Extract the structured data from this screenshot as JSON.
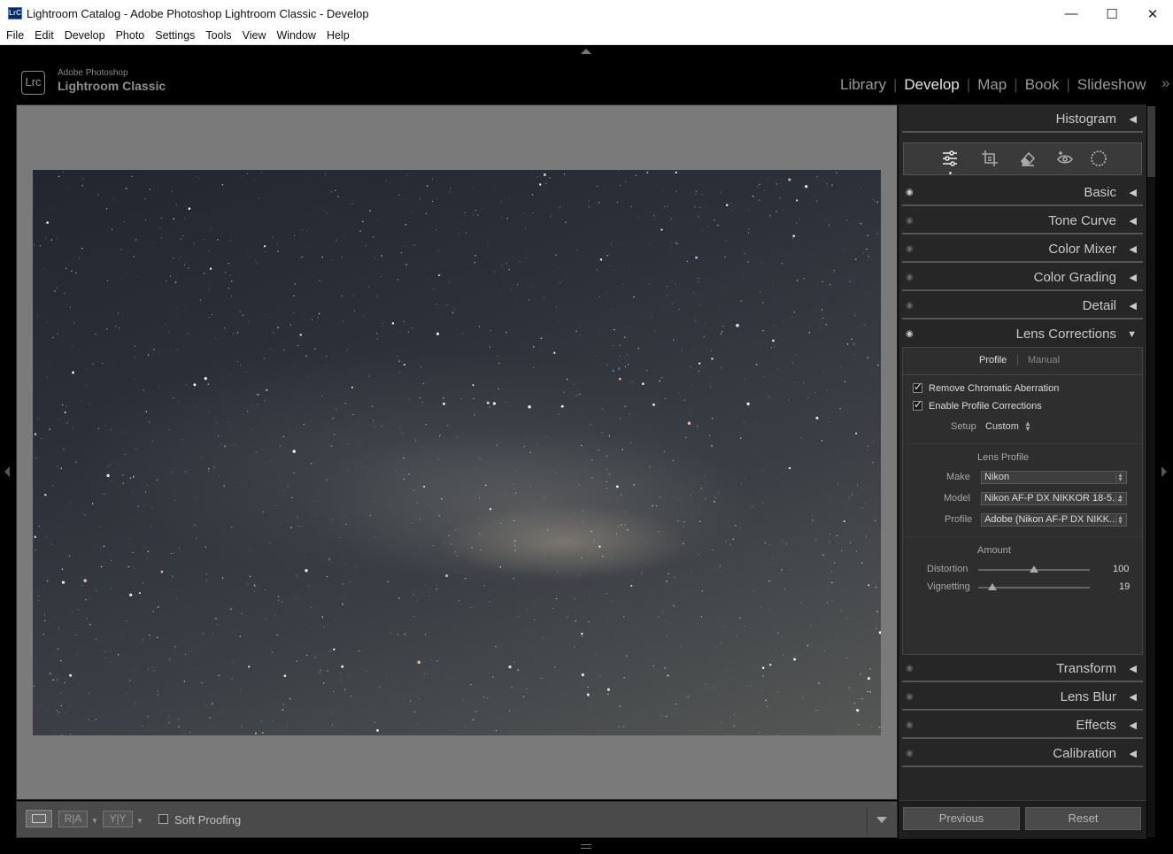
{
  "window": {
    "title": "Lightroom Catalog - Adobe Photoshop Lightroom Classic - Develop",
    "app_badge": "LrC",
    "minimize": "—",
    "maximize": "☐",
    "close": "✕"
  },
  "menu": [
    "File",
    "Edit",
    "Develop",
    "Photo",
    "Settings",
    "Tools",
    "View",
    "Window",
    "Help"
  ],
  "identity": {
    "badge": "Lrc",
    "company": "Adobe Photoshop",
    "product": "Lightroom Classic"
  },
  "modules": {
    "library": "Library",
    "develop": "Develop",
    "map": "Map",
    "book": "Book",
    "slideshow": "Slideshow",
    "more": "»"
  },
  "panels": {
    "histogram": "Histogram",
    "basic": "Basic",
    "tone_curve": "Tone Curve",
    "color_mixer": "Color Mixer",
    "color_grading": "Color Grading",
    "detail": "Detail",
    "lens_corrections": "Lens Corrections",
    "transform": "Transform",
    "lens_blur": "Lens Blur",
    "effects": "Effects",
    "calibration": "Calibration"
  },
  "tools": [
    "edit-sliders-icon",
    "crop-icon",
    "eraser-icon",
    "red-eye-icon",
    "masking-icon"
  ],
  "lens": {
    "tab_profile": "Profile",
    "tab_manual": "Manual",
    "chk_ca": "Remove Chromatic Aberration",
    "chk_profile": "Enable Profile Corrections",
    "setup_label": "Setup",
    "setup_value": "Custom",
    "lens_profile_header": "Lens Profile",
    "make_label": "Make",
    "make_value": "Nikon",
    "model_label": "Model",
    "model_value": "Nikon AF-P DX NIKKOR 18-5...",
    "profile_label": "Profile",
    "profile_value": "Adobe (Nikon AF-P DX NIKK...",
    "amount_header": "Amount",
    "distortion_label": "Distortion",
    "distortion_value": "100",
    "distortion_fraction": 0.5,
    "vignetting_label": "Vignetting",
    "vignetting_value": "19",
    "vignetting_fraction": 0.13
  },
  "toolbar": {
    "soft_proofing": "Soft Proofing",
    "ra": "R|A",
    "yy": "Y|Y"
  },
  "buttons": {
    "previous": "Previous",
    "reset": "Reset"
  },
  "colors": {
    "accent": "#0a5fb4",
    "panel": "#262626",
    "viewer": "#7a7a7a"
  }
}
